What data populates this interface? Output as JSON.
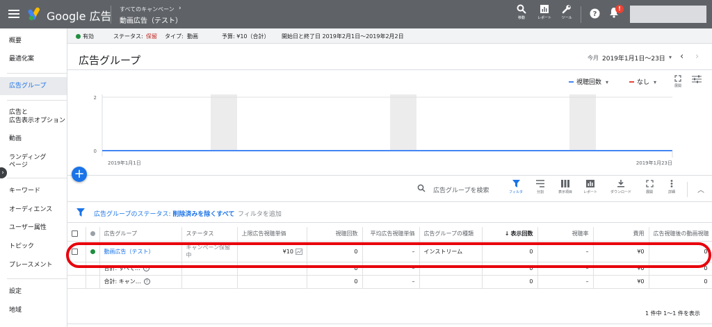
{
  "topbar": {
    "product_name": "Google 広告",
    "breadcrumb_small": "すべてのキャンペーン",
    "breadcrumb_arrow": "›",
    "breadcrumb_main": "動画広告（テスト）",
    "tools": [
      {
        "label": "移動",
        "icon": "search-icon"
      },
      {
        "label": "レポート",
        "icon": "report-icon"
      },
      {
        "label": "ツール",
        "icon": "wrench-icon"
      }
    ],
    "notification_badge": "!"
  },
  "sidebar": {
    "items": [
      {
        "label": "概要"
      },
      {
        "label": "最適化案"
      },
      {
        "label": "広告グループ",
        "active": true
      },
      {
        "label": "広告と"
      },
      {
        "label": "広告表示オプション"
      },
      {
        "label": "動画"
      },
      {
        "label": "ランディング"
      },
      {
        "label": "ページ"
      },
      {
        "label": "キーワード"
      },
      {
        "label": "オーディエンス"
      },
      {
        "label": "ユーザー属性"
      },
      {
        "label": "トピック"
      },
      {
        "label": "プレースメント"
      },
      {
        "label": "設定"
      },
      {
        "label": "地域"
      }
    ],
    "toggle_glyph": "›"
  },
  "status_bar": {
    "status": "有効",
    "status_color": "#1e8e3e",
    "status_label": "ステータス:",
    "status_value": "保留",
    "type_label": "タイプ:",
    "type_value": "動画",
    "budget": "予算: ¥10（合計）",
    "dates": "開始日と終了日 2019年2月1日〜2019年2月2日"
  },
  "header": {
    "title": "広告グループ",
    "date_prefix": "今月",
    "date_range": "2019年1月1日〜23日",
    "dropdown_glyph": "▾",
    "prev_glyph": "‹",
    "next_glyph": "›"
  },
  "chart": {
    "metric1": "視聴回数",
    "metric1_color": "#4285f4",
    "metric2": "なし",
    "metric2_color": "#ea4335",
    "tool_expand": "展開",
    "dropdown_glyph": "▾"
  },
  "chart_data": {
    "type": "line",
    "series": [
      {
        "name": "視聴回数",
        "values": [
          0,
          0
        ]
      }
    ],
    "x": [
      "2019年1月1日",
      "2019年1月23日"
    ],
    "yticks": [
      "0",
      "1",
      "2"
    ],
    "ylim": [
      0,
      2
    ],
    "xlabel_start": "2019年1月1日",
    "xlabel_end": "2019年1月23日"
  },
  "fab_label": "+",
  "table_toolbar": {
    "search_placeholder": "広告グループを検索",
    "tools": [
      {
        "label": "フィルタ",
        "active": true
      },
      {
        "label": "分割"
      },
      {
        "label": "表示項目"
      },
      {
        "label": "レポート"
      },
      {
        "label": "ダウンロード"
      },
      {
        "label": "展開"
      },
      {
        "label": "詳細"
      }
    ],
    "collapse_glyph": "︿"
  },
  "filter": {
    "label": "広告グループのステータス:",
    "value": "削除済みを除くすべて",
    "add": "フィルタを追加"
  },
  "table": {
    "columns": [
      "広告グループ",
      "ステータス",
      "上限広告視聴単価",
      "視聴回数",
      "平均広告視聴単価",
      "広告グループの種類",
      "表示回数",
      "視聴率",
      "費用",
      "広告視聴後の動画視聴"
    ],
    "sort_arrow": "↓",
    "row": {
      "name": "動画広告（テスト）",
      "status": "キャンペーン保留中",
      "bid": "¥10",
      "views": "0",
      "avg_cpv": "–",
      "type": "インストリーム",
      "impressions": "0",
      "view_rate": "–",
      "cost": "¥0",
      "earned_views": "0"
    },
    "totals": [
      {
        "label": "合計: すべて…",
        "views": "0",
        "avg_cpv": "–",
        "impressions": "0",
        "view_rate": "–",
        "cost": "¥0",
        "earned_views": "0"
      },
      {
        "label": "合計: キャン…",
        "views": "0",
        "avg_cpv": "–",
        "impressions": "0",
        "view_rate": "–",
        "cost": "¥0",
        "earned_views": "0"
      }
    ],
    "help_glyph": "?"
  },
  "pager": "1 件中 1〜1 件を表示"
}
